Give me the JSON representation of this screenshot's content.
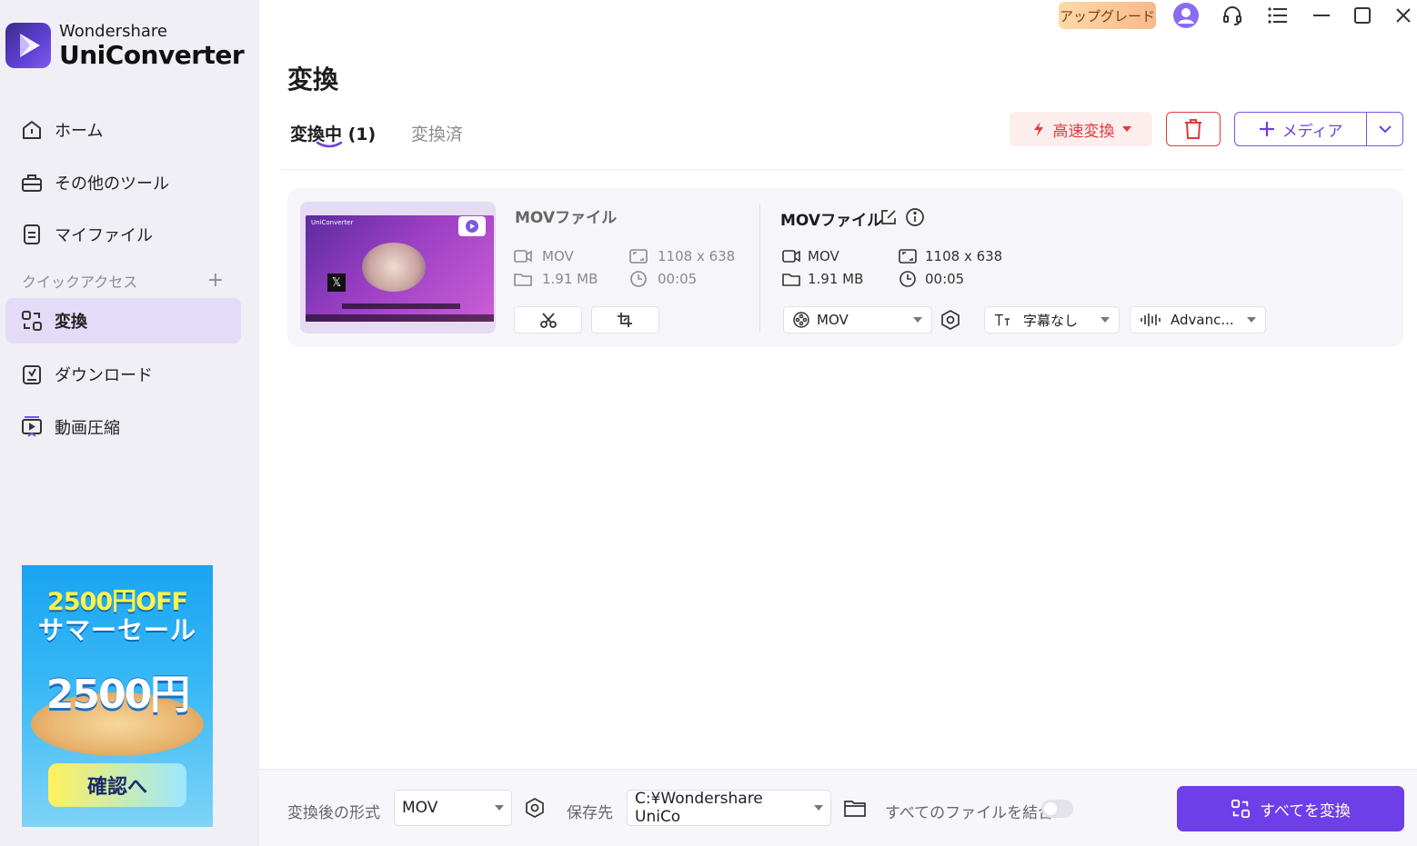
{
  "app": {
    "brand_line1": "Wondershare",
    "brand_line2": "UniConverter"
  },
  "window_bar": {
    "upgrade_label": "アップグレード",
    "icons": [
      "avatar-icon",
      "headset-icon",
      "menu-list-icon",
      "minimize-icon",
      "maximize-icon",
      "close-icon"
    ]
  },
  "sidebar": {
    "items": [
      {
        "label": "ホーム",
        "icon": "home-icon"
      },
      {
        "label": "その他のツール",
        "icon": "toolbox-icon"
      },
      {
        "label": "マイファイル",
        "icon": "file-icon"
      },
      {
        "label": "変換",
        "icon": "convert-icon",
        "active": true
      },
      {
        "label": "ダウンロード",
        "icon": "download-icon"
      },
      {
        "label": "動画圧縮",
        "icon": "compress-icon"
      }
    ],
    "quick_access_label": "クイックアクセス",
    "quick_access_add": "+"
  },
  "promo": {
    "line1": "2500円OFF",
    "line2": "サマーセール",
    "big_text": "2500円",
    "cta": "確認へ"
  },
  "main": {
    "title": "変換",
    "tabs": [
      {
        "label": "変換中 (1)",
        "active": true
      },
      {
        "label": "変換済",
        "active": false
      }
    ],
    "fast_convert_label": "高速変換",
    "add_media_label": "メディア"
  },
  "file_card": {
    "thumbnail_brand": "UniConverter",
    "source": {
      "title": "MOVファイル",
      "format": "MOV",
      "resolution": "1108 x 638",
      "size": "1.91 MB",
      "duration": "00:05"
    },
    "output": {
      "title": "MOVファイル",
      "format": "MOV",
      "resolution": "1108 x 638",
      "size": "1.91 MB",
      "duration": "00:05",
      "format_select": "MOV",
      "subtitle_select": "字幕なし",
      "audio_select": "Advanc..."
    }
  },
  "bottom_bar": {
    "output_format_label": "変換後の形式",
    "output_format_value": "MOV",
    "save_to_label": "保存先",
    "save_to_value": "C:¥Wondershare UniCo",
    "merge_label": "すべてのファイルを結合",
    "merge_enabled": false,
    "convert_all_label": "すべてを変換"
  },
  "colors": {
    "accent": "#6e3ee8",
    "danger": "#e23a3a",
    "sidebar_bg": "#f1eff6",
    "active_nav": "#e3dbf7"
  }
}
